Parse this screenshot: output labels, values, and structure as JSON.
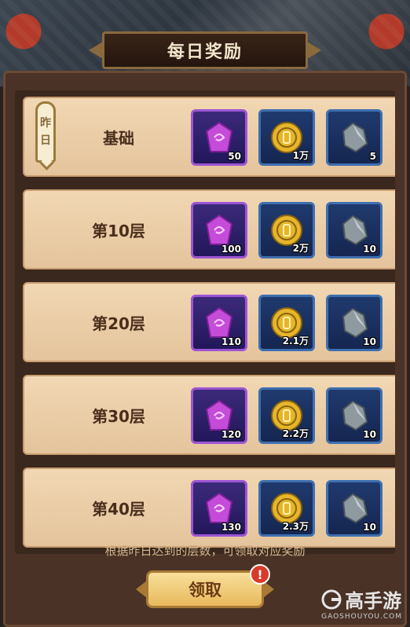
{
  "header": {
    "title": "每日奖励"
  },
  "rows": [
    {
      "label": "基础",
      "tag_lines": [
        "昨",
        "日"
      ],
      "rewards": [
        {
          "icon": "purple-gem-icon",
          "qty": "50"
        },
        {
          "icon": "gold-coin-icon",
          "qty": "1万"
        },
        {
          "icon": "silver-stone-icon",
          "qty": "5"
        }
      ]
    },
    {
      "label": "第10层",
      "rewards": [
        {
          "icon": "purple-gem-icon",
          "qty": "100"
        },
        {
          "icon": "gold-coin-icon",
          "qty": "2万"
        },
        {
          "icon": "silver-stone-icon",
          "qty": "10"
        }
      ]
    },
    {
      "label": "第20层",
      "rewards": [
        {
          "icon": "purple-gem-icon",
          "qty": "110"
        },
        {
          "icon": "gold-coin-icon",
          "qty": "2.1万"
        },
        {
          "icon": "silver-stone-icon",
          "qty": "10"
        }
      ]
    },
    {
      "label": "第30层",
      "rewards": [
        {
          "icon": "purple-gem-icon",
          "qty": "120"
        },
        {
          "icon": "gold-coin-icon",
          "qty": "2.2万"
        },
        {
          "icon": "silver-stone-icon",
          "qty": "10"
        }
      ]
    },
    {
      "label": "第40层",
      "rewards": [
        {
          "icon": "purple-gem-icon",
          "qty": "130"
        },
        {
          "icon": "gold-coin-icon",
          "qty": "2.3万"
        },
        {
          "icon": "silver-stone-icon",
          "qty": "10"
        }
      ]
    }
  ],
  "footer": {
    "hint": "根据昨日达到的层数，可领取对应奖励",
    "claim_label": "领取",
    "badge": "!"
  },
  "watermark": {
    "main": "高手游",
    "sub": "GAOSHOUYOU.COM"
  },
  "colors": {
    "row_bg": "#f1d7b3",
    "panel": "#4a3226",
    "accent": "#e8b95c"
  }
}
